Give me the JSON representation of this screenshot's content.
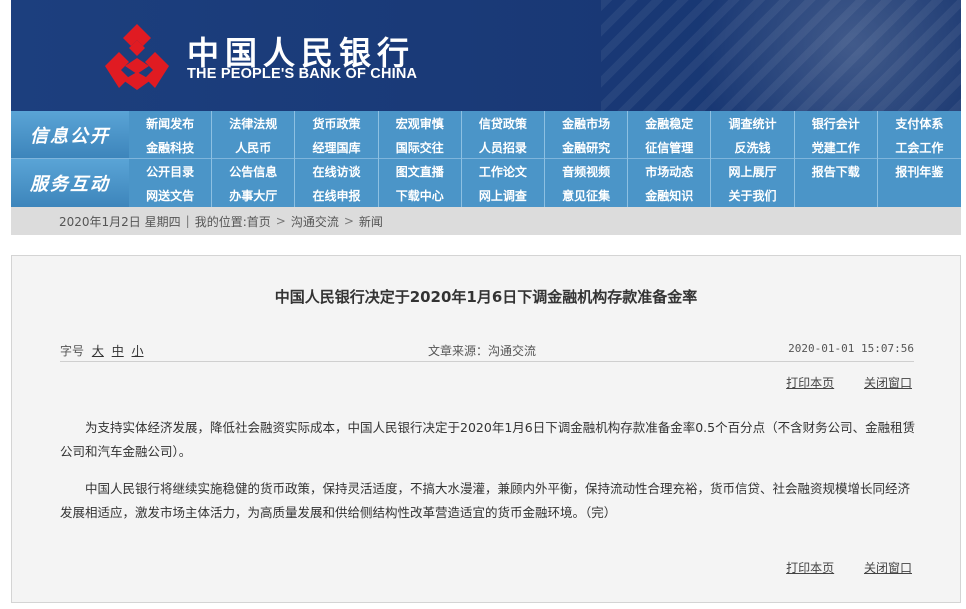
{
  "header": {
    "logo_cn": "中国人民银行",
    "logo_en": "THE PEOPLE'S BANK OF CHINA",
    "logo_icon": "pboc-emblem-icon",
    "brand_color": "#1c3f7e",
    "logo_color": "#e01b22"
  },
  "nav": {
    "groups": [
      {
        "title": "信息公开",
        "items": [
          "新闻发布",
          "法律法规",
          "货币政策",
          "宏观审慎",
          "信贷政策",
          "金融市场",
          "金融稳定",
          "调查统计",
          "银行会计",
          "支付体系",
          "金融科技",
          "人民币",
          "经理国库",
          "国际交往",
          "人员招录",
          "金融研究",
          "征信管理",
          "反洗钱",
          "党建工作",
          "工会工作"
        ]
      },
      {
        "title": "服务互动",
        "items": [
          "公开目录",
          "公告信息",
          "在线访谈",
          "图文直播",
          "工作论文",
          "音频视频",
          "市场动态",
          "网上展厅",
          "报告下载",
          "报刊年鉴",
          "网送文告",
          "办事大厅",
          "在线申报",
          "下载中心",
          "网上调查",
          "意见征集",
          "金融知识",
          "关于我们",
          "",
          ""
        ]
      }
    ],
    "color": "#4b95c8"
  },
  "breadcrumb": {
    "date": "2020年1月2日",
    "weekday": "星期四",
    "location_label": "我的位置:",
    "home": "首页",
    "section": "沟通交流",
    "page": "新闻",
    "arrow": ">",
    "divider": "|"
  },
  "article": {
    "title": "中国人民银行决定于2020年1月6日下调金融机构存款准备金率",
    "font_size_label": "字号",
    "size_large": "大",
    "size_medium": "中",
    "size_small": "小",
    "source": "文章来源：沟通交流",
    "datetime": "2020-01-01 15:07:56",
    "print_label": "打印本页",
    "close_label": "关闭窗口",
    "paragraphs": [
      "为支持实体经济发展，降低社会融资实际成本，中国人民银行决定于2020年1月6日下调金融机构存款准备金率0.5个百分点（不含财务公司、金融租赁公司和汽车金融公司）。",
      "中国人民银行将继续实施稳健的货币政策，保持灵活适度，不搞大水漫灌，兼顾内外平衡，保持流动性合理充裕，货币信贷、社会融资规模增长同经济发展相适应，激发市场主体活力，为高质量发展和供给侧结构性改革营造适宜的货币金融环境。（完）"
    ]
  }
}
